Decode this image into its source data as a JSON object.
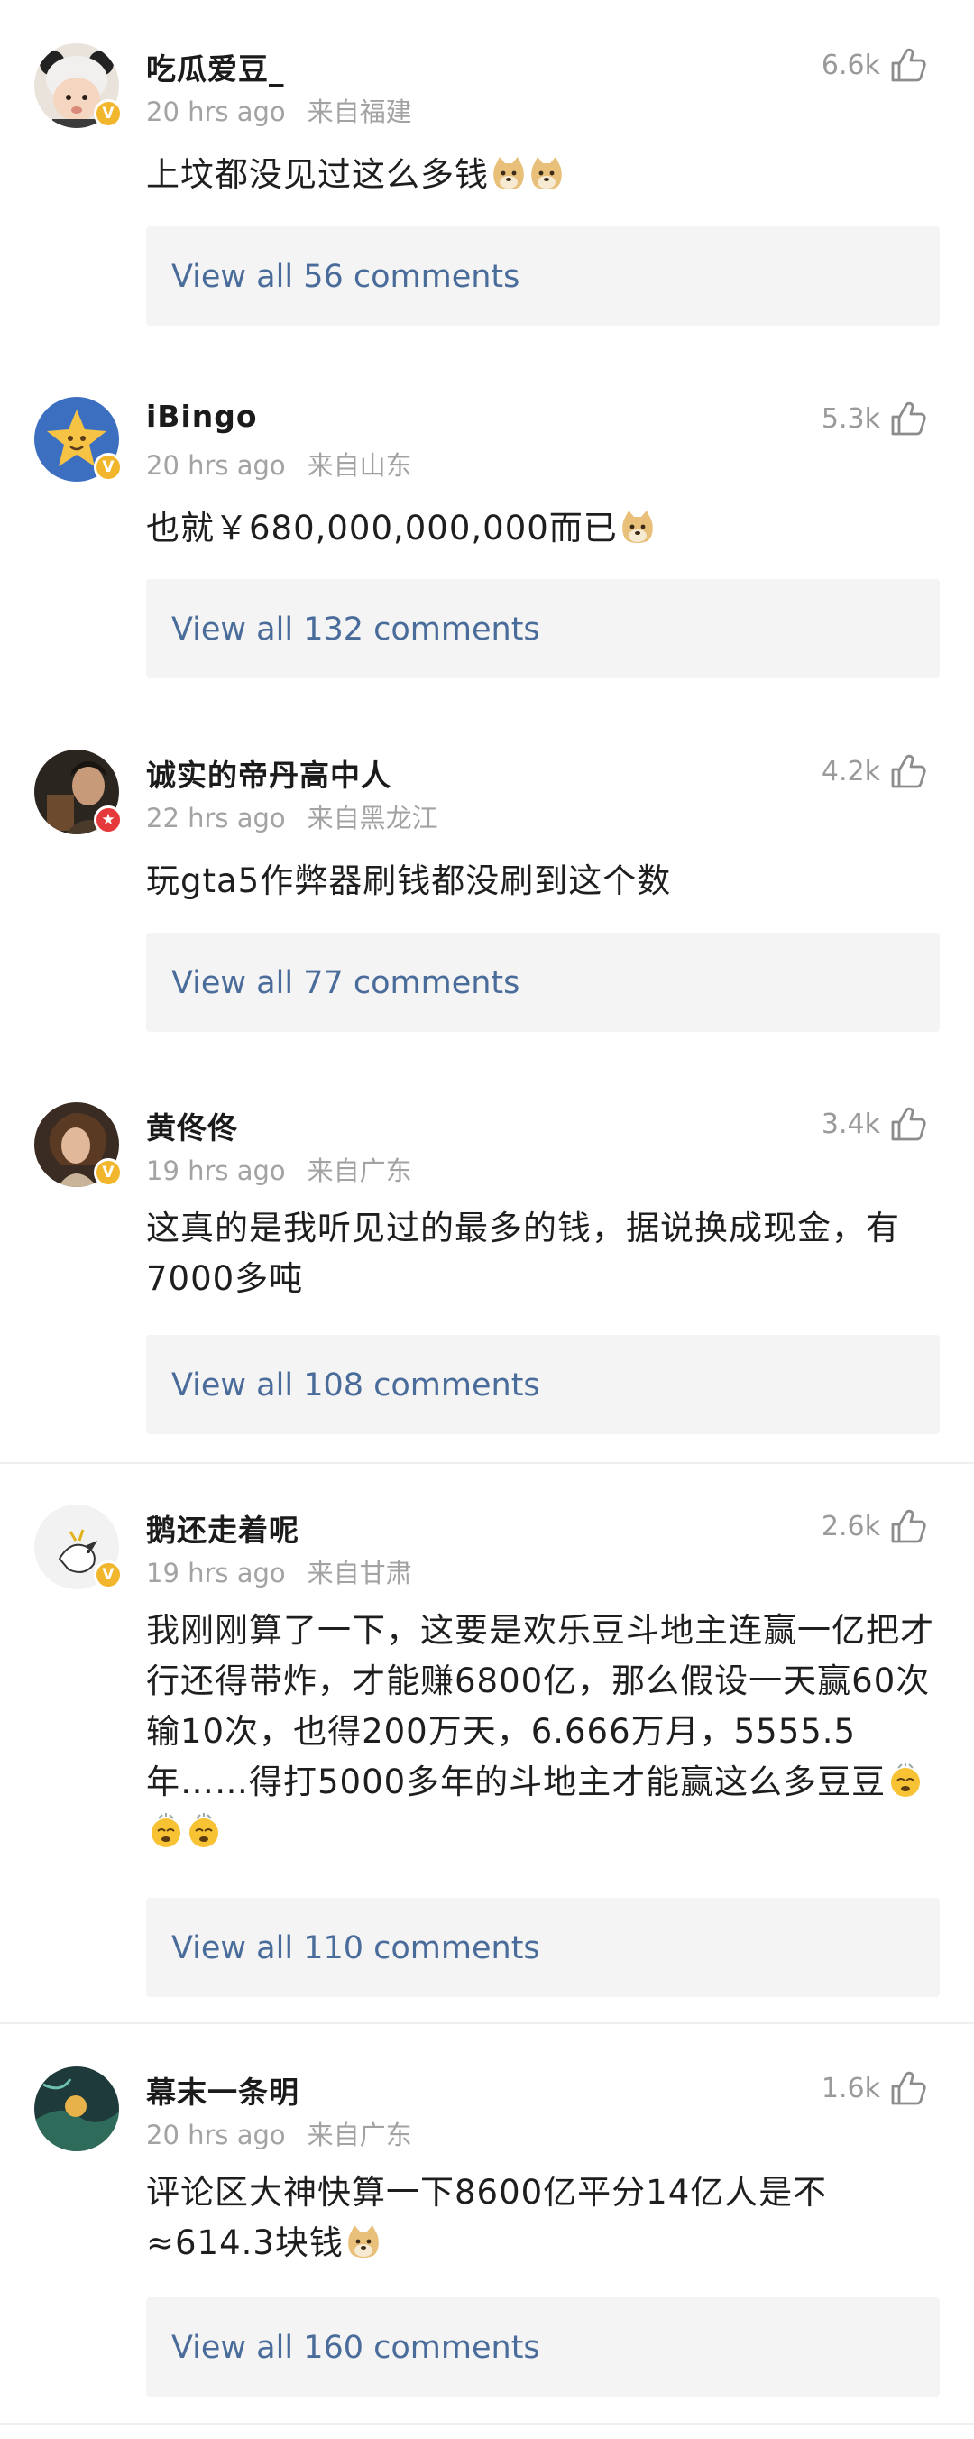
{
  "comments": [
    {
      "name": "吃瓜爱豆_",
      "time": "20 hrs ago",
      "location": "来自福建",
      "likes": "6.6k",
      "text": "上坟都没见过这么多钱",
      "emoji": [
        "doge-emoji",
        "doge-emoji"
      ],
      "replies": "View all 56 comments",
      "avatar_icon": "panda-hat-kid-avatar",
      "badge": "V"
    },
    {
      "name": "iBingo",
      "time": "20 hrs ago",
      "location": "来自山东",
      "likes": "5.3k",
      "text": "也就￥680,000,000,000而已",
      "emoji": [
        "doge-emoji"
      ],
      "replies": "View all 132 comments",
      "avatar_icon": "star-character-avatar",
      "badge": "V"
    },
    {
      "name": "诚实的帝丹高中人",
      "time": "22 hrs ago",
      "location": "来自黑龙江",
      "likes": "4.2k",
      "text": "玩gta5作弊器刷钱都没刷到这个数",
      "emoji": [],
      "replies": "View all 77 comments",
      "avatar_icon": "portrait-avatar",
      "badge": "★"
    },
    {
      "name": "黄佟佟",
      "time": "19 hrs ago",
      "location": "来自广东",
      "likes": "3.4k",
      "text": "这真的是我听见过的最多的钱，据说换成现金，有7000多吨",
      "emoji": [],
      "replies": "View all 108 comments",
      "avatar_icon": "painting-woman-avatar",
      "badge": "V"
    },
    {
      "name": "鹅还走着呢",
      "time": "19 hrs ago",
      "location": "来自甘肃",
      "likes": "2.6k",
      "text": "我刚刚算了一下，这要是欢乐豆斗地主连赢一亿把才行还得带炸，才能赚6800亿，那么假设一天赢60次输10次，也得200万天，6.666万月，5555.5年……得打5000多年的斗地主才能赢这么多豆豆",
      "emoji": [
        "dizzy-face-emoji",
        "dizzy-face-emoji",
        "dizzy-face-emoji"
      ],
      "replies": "View all 110 comments",
      "avatar_icon": "goose-sketch-avatar",
      "badge": "V"
    },
    {
      "name": "幕末一条明",
      "time": "20 hrs ago",
      "location": "来自广东",
      "likes": "1.6k",
      "text": "评论区大神快算一下8600亿平分14亿人是不≈614.3块钱",
      "emoji": [
        "doge-emoji"
      ],
      "replies": "View all 160 comments",
      "avatar_icon": "landscape-avatar",
      "badge": null
    }
  ],
  "colors": {
    "reply_link": "#4a6c9a",
    "meta_gray": "#a3a3a3",
    "badge_gold": "#f2b62d",
    "badge_red": "#e6393b"
  }
}
